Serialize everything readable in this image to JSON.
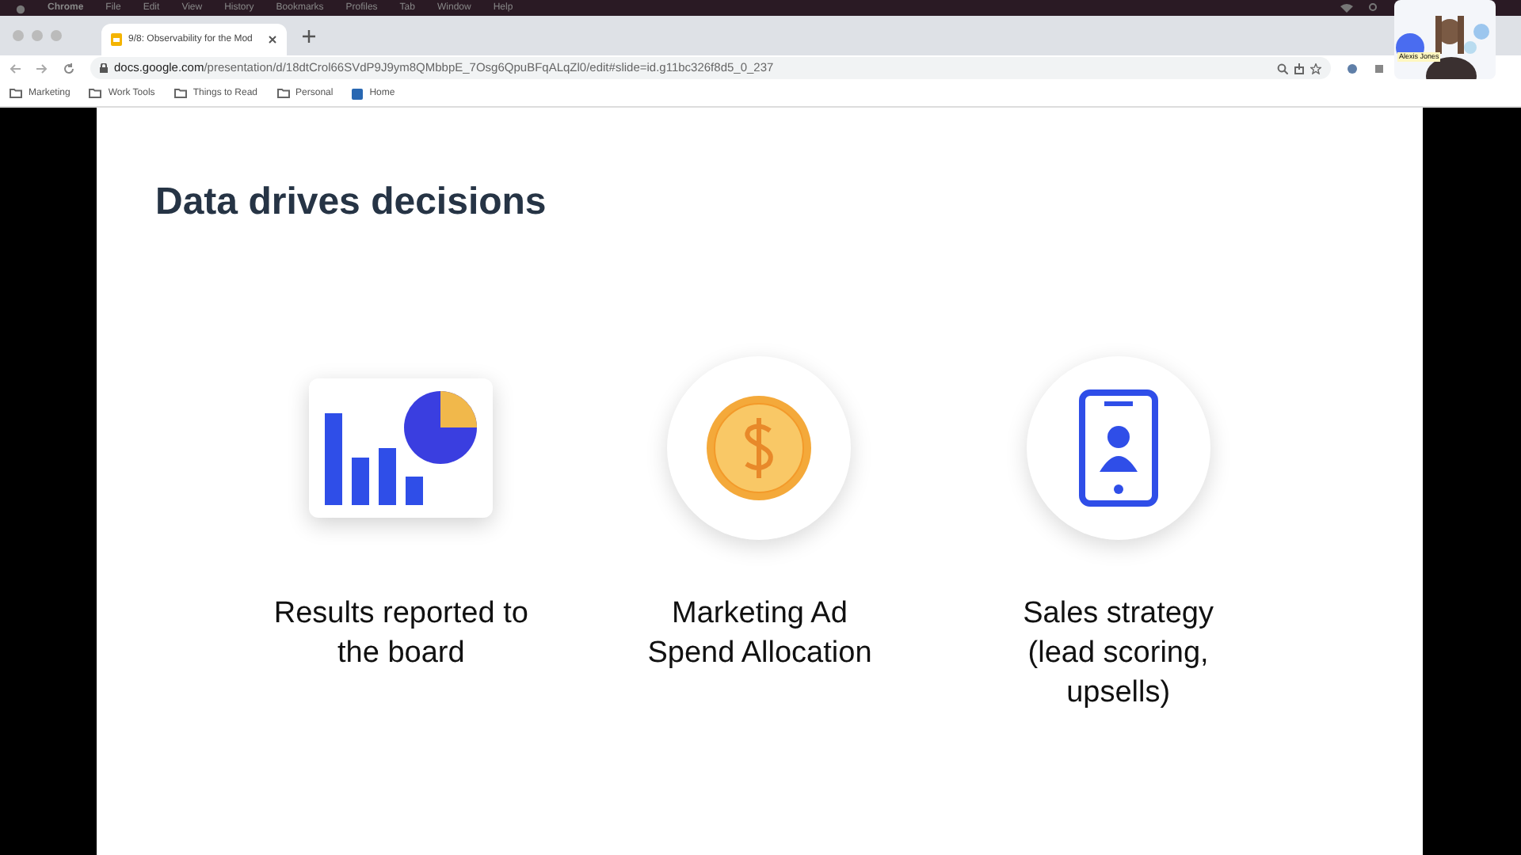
{
  "menu_bar": {
    "items": [
      "Chrome",
      "File",
      "Edit",
      "View",
      "History",
      "Bookmarks",
      "Profiles",
      "Tab",
      "Window",
      "Help"
    ]
  },
  "tabs": [
    {
      "label": "9/8: Observability for the Mod",
      "selected": true
    }
  ],
  "address_bar": {
    "url_host": "docs.google.com",
    "url_path": "/presentation/d/18dtCrol66SVdP9J9ym8QMbbpE_7Osg6QpuBFqALqZl0/edit#slide=id.g11bc326f8d5_0_237"
  },
  "bookmarks": [
    {
      "label": "Marketing",
      "kind": "folder"
    },
    {
      "label": "Work Tools",
      "kind": "folder"
    },
    {
      "label": "Things to Read",
      "kind": "folder"
    },
    {
      "label": "Personal",
      "kind": "folder"
    },
    {
      "label": "Home",
      "kind": "link"
    }
  ],
  "slide": {
    "title": "Data drives decisions",
    "items": [
      {
        "kind": "chart",
        "caption": "Results reported to the board"
      },
      {
        "kind": "dollar",
        "caption": "Marketing Ad Spend Allocation"
      },
      {
        "kind": "phone",
        "caption": "Sales strategy (lead scoring, upsells)"
      }
    ]
  },
  "video_overlay": {
    "name_label": "Alexis Jones"
  }
}
